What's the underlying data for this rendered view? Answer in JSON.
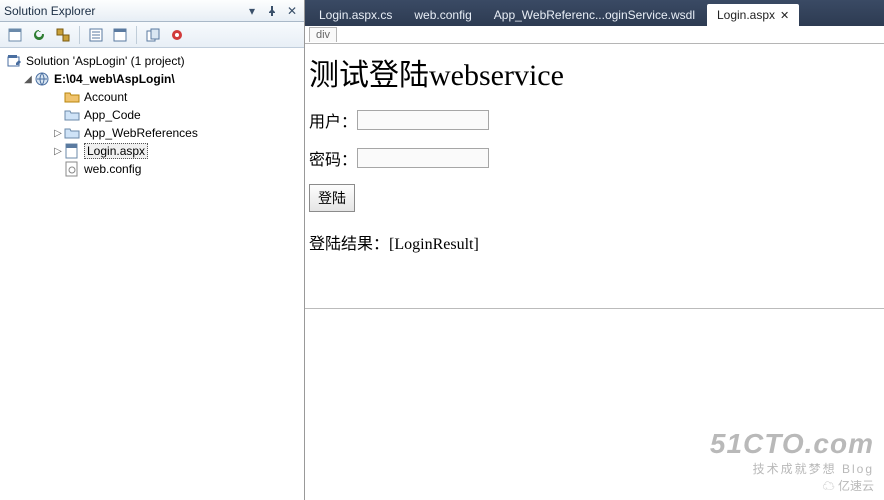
{
  "panel": {
    "title": "Solution Explorer",
    "solution_label": "Solution 'AspLogin' (1 project)",
    "project_label": "E:\\04_web\\AspLogin\\",
    "items": {
      "account": "Account",
      "app_code": "App_Code",
      "app_webref": "App_WebReferences",
      "login": "Login.aspx",
      "webconfig": "web.config"
    }
  },
  "tabs": [
    {
      "label": "Login.aspx.cs",
      "active": false
    },
    {
      "label": "web.config",
      "active": false
    },
    {
      "label": "App_WebReferenc...oginService.wsdl",
      "active": false
    },
    {
      "label": "Login.aspx",
      "active": true
    }
  ],
  "outline_tag": "div",
  "page": {
    "heading": "测试登陆webservice",
    "user_label": "用户：",
    "pwd_label": "密码：",
    "login_button": "登陆",
    "result_prefix": "登陆结果：",
    "result_placeholder": "[LoginResult]"
  },
  "watermark": {
    "big": "51CTO.com",
    "sub": "技术成就梦想   Blog",
    "brand": "亿速云"
  }
}
